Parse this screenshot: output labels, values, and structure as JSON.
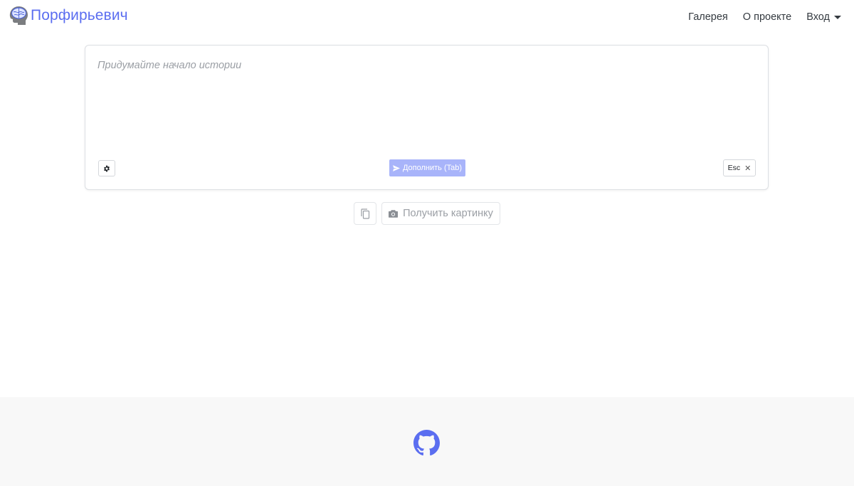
{
  "header": {
    "brand_name": "Порфирьевич",
    "logo_icon": "brain-head-icon",
    "nav": {
      "gallery": "Галерея",
      "about": "О проекте",
      "login": "Вход"
    }
  },
  "editor": {
    "placeholder": "Придумайте начало истории",
    "value": "",
    "settings_icon": "gear-icon",
    "complete_label": "Дополнить (Tab)",
    "complete_icon": "send-icon",
    "esc_label": "Esc",
    "esc_icon": "close-icon"
  },
  "actions": {
    "copy_icon": "copy-icon",
    "get_image_label": "Получить картинку",
    "get_image_icon": "camera-icon"
  },
  "footer": {
    "github_icon": "github-icon"
  },
  "colors": {
    "brand": "#5b6ef0",
    "primary_disabled": "#a8b4fa",
    "footer_bg": "#f8f8f8",
    "muted_text": "#9a9ea4"
  }
}
